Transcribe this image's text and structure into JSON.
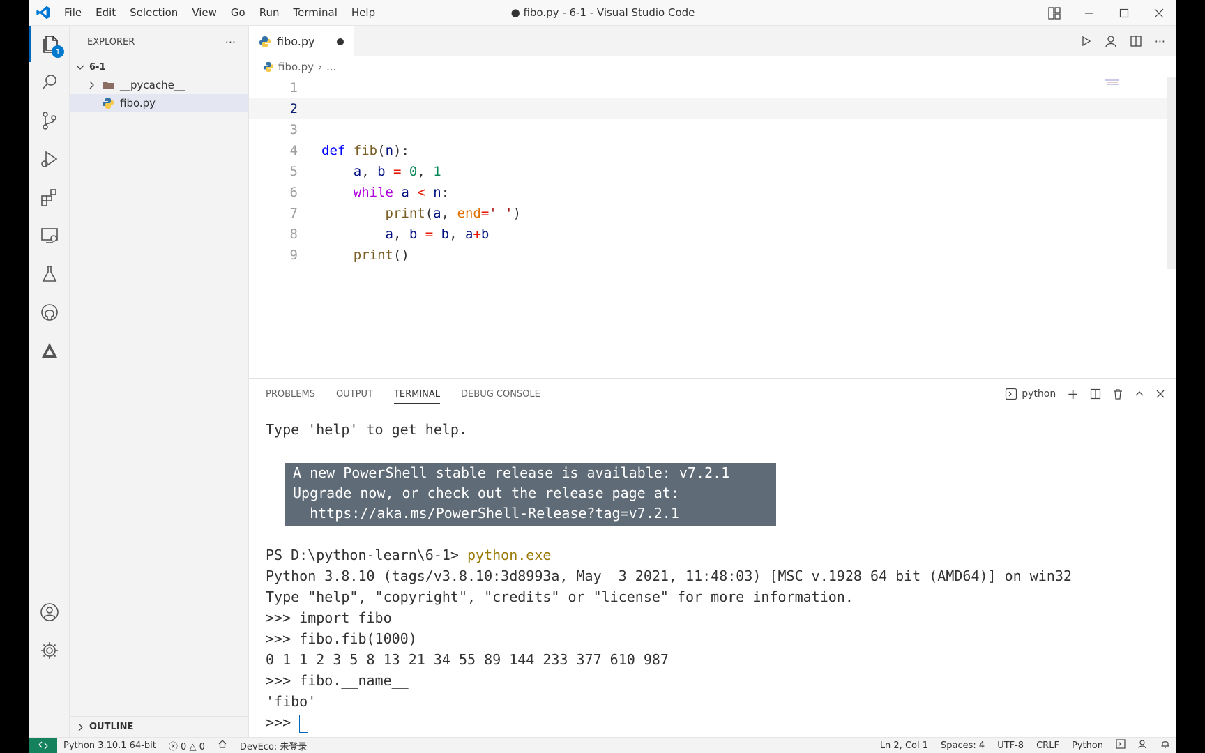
{
  "window": {
    "title": "● fibo.py - 6-1 - Visual Studio Code"
  },
  "menu": [
    "File",
    "Edit",
    "Selection",
    "View",
    "Go",
    "Run",
    "Terminal",
    "Help"
  ],
  "activity": {
    "explorer_badge": "1"
  },
  "sidebar": {
    "title": "EXPLORER",
    "more": "···",
    "folder": "6-1",
    "items": [
      {
        "label": "__pycache__",
        "icon": "folder-icon"
      },
      {
        "label": "fibo.py",
        "icon": "python-icon"
      }
    ],
    "outline": "OUTLINE"
  },
  "editor": {
    "tab": "fibo.py",
    "breadcrumb_file": "fibo.py",
    "breadcrumb_more": "...",
    "line_numbers": [
      "1",
      "2",
      "3",
      "4",
      "5",
      "6",
      "7",
      "8",
      "9"
    ],
    "lines": [
      "",
      "",
      "",
      "def fib(n):",
      "    a, b = 0, 1",
      "    while a < n:",
      "        print(a, end=' ')",
      "        a, b = b, a+b",
      "    print()"
    ]
  },
  "panel": {
    "tabs": [
      "PROBLEMS",
      "OUTPUT",
      "TERMINAL",
      "DEBUG CONSOLE"
    ],
    "active_tab": "TERMINAL",
    "shell": "python",
    "terminal": {
      "line1": "Type 'help' to get help.",
      "banner": [
        "A new PowerShell stable release is available: v7.2.1",
        "Upgrade now, or check out the release page at:",
        "  https://aka.ms/PowerShell-Release?tag=v7.2.1"
      ],
      "prompt": "PS D:\\python-learn\\6-1> ",
      "command": "python.exe",
      "output": [
        "Python 3.8.10 (tags/v3.8.10:3d8993a, May  3 2021, 11:48:03) [MSC v.1928 64 bit (AMD64)] on win32",
        "Type \"help\", \"copyright\", \"credits\" or \"license\" for more information.",
        ">>> import fibo",
        ">>> fibo.fib(1000)",
        "0 1 1 2 3 5 8 13 21 34 55 89 144 233 377 610 987",
        ">>> fibo.__name__",
        "'fibo'"
      ],
      "last_prompt": ">>> "
    }
  },
  "statusbar": {
    "interpreter": "Python 3.10.1 64-bit",
    "errors": "0",
    "warnings": "0",
    "deveco": "DevEco: 未登录",
    "position": "Ln 2, Col 1",
    "spaces": "Spaces: 4",
    "encoding": "UTF-8",
    "eol": "CRLF",
    "language": "Python"
  }
}
